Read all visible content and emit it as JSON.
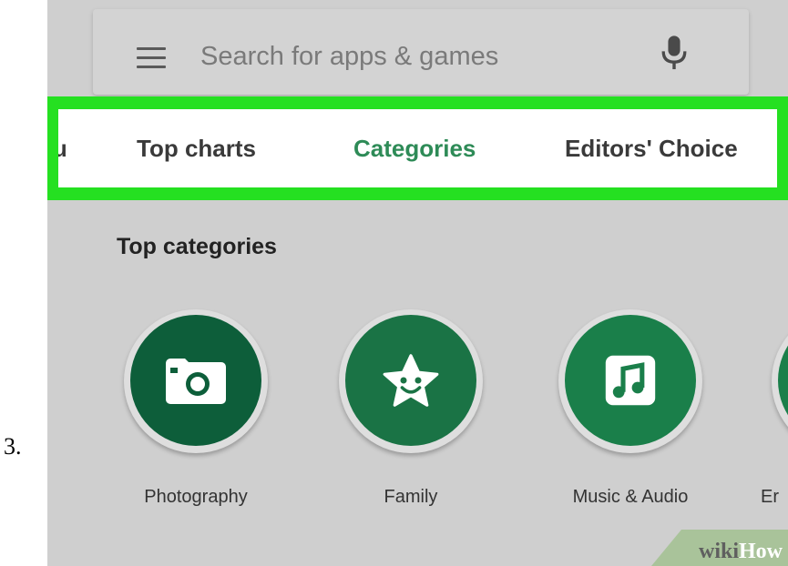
{
  "step_number": "3.",
  "search": {
    "placeholder": "Search for apps & games"
  },
  "tabs": [
    {
      "label": "ou",
      "active": false
    },
    {
      "label": "Top charts",
      "active": false
    },
    {
      "label": "Categories",
      "active": true
    },
    {
      "label": "Editors' Choice",
      "active": false
    }
  ],
  "section": {
    "title": "Top categories"
  },
  "categories": [
    {
      "label": "Photography",
      "icon": "camera-icon",
      "color": "#0d5e3a"
    },
    {
      "label": "Family",
      "icon": "star-face-icon",
      "color": "#1a7345"
    },
    {
      "label": "Music & Audio",
      "icon": "music-note-icon",
      "color": "#1a7f4a"
    },
    {
      "label": "Er",
      "icon": "unknown-icon",
      "color": "#1a7f4a"
    }
  ],
  "colors": {
    "highlight": "#25e021",
    "active_tab": "#2e8b57",
    "background": "#cfcfcf"
  },
  "watermark": {
    "part1": "wiki",
    "part2": "How"
  }
}
